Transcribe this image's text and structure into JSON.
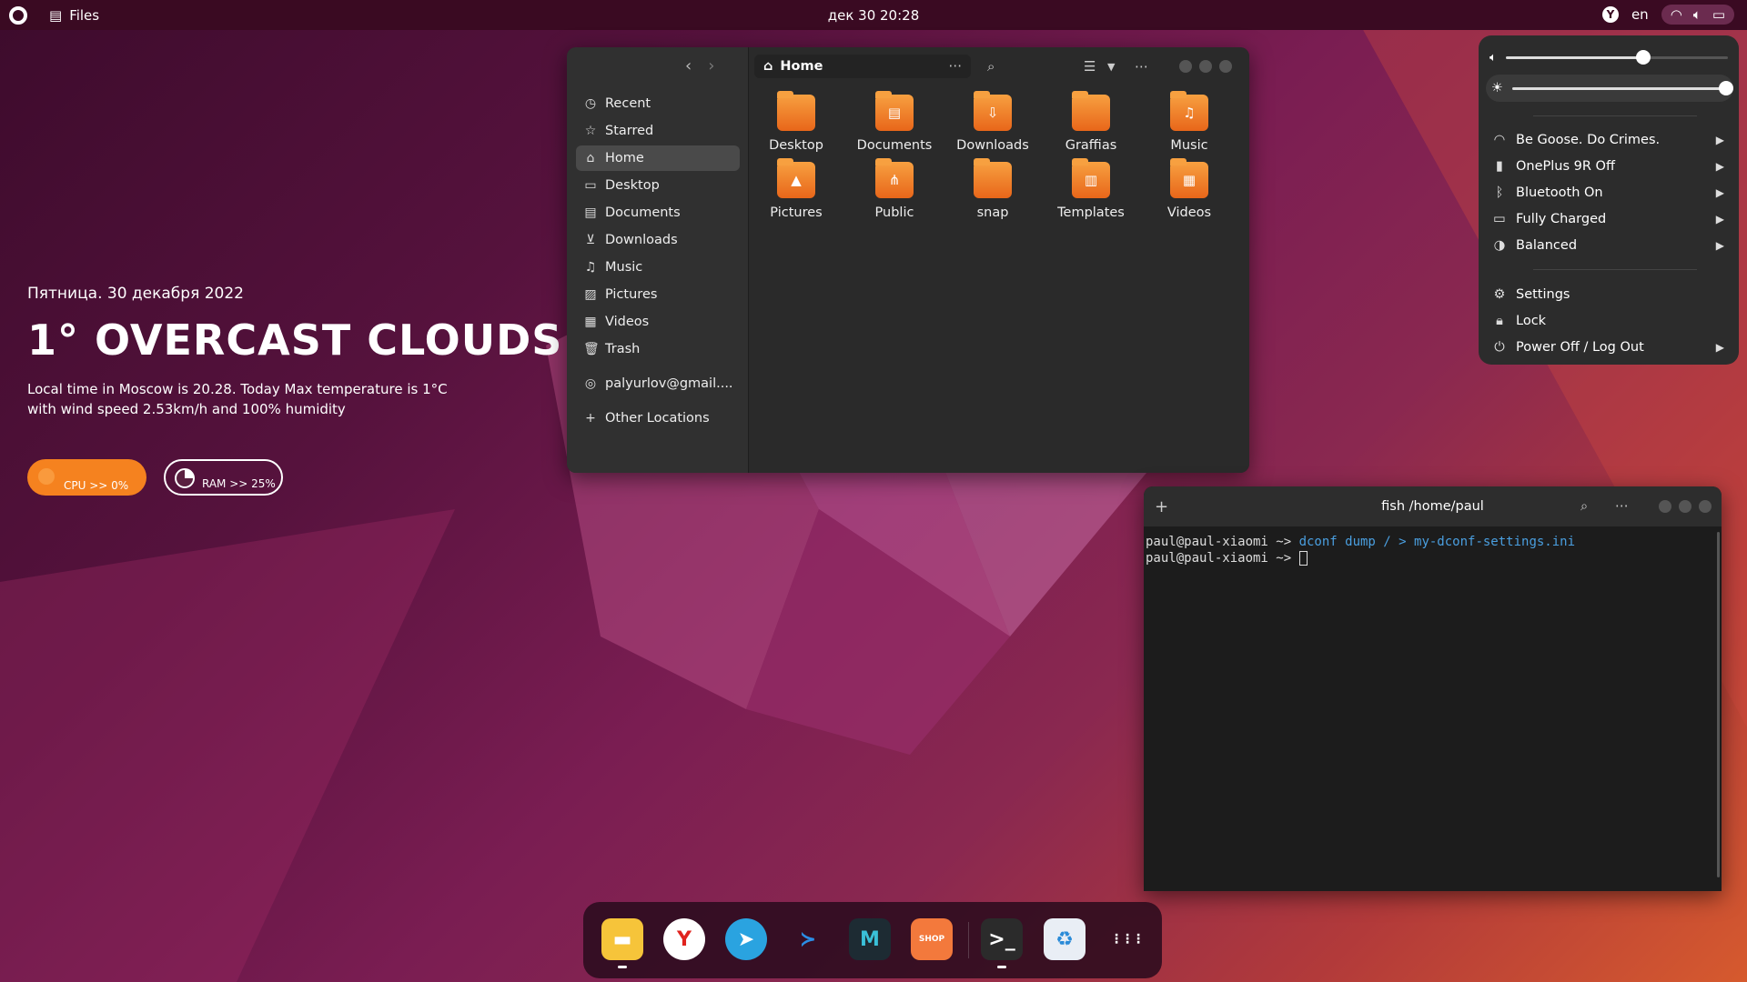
{
  "topbar": {
    "app_name": "Files",
    "clock": "дек 30  20:28",
    "lang": "en"
  },
  "weather": {
    "date": "Пятница. 30 декабря 2022",
    "title": "1° OVERCAST CLOUDS",
    "desc": "Local time in Moscow  is 20.28. Today Max temperature is 1°C with wind speed 2.53km/h and 100% humidity"
  },
  "meters": {
    "cpu": "CPU >> 0%",
    "ram": "RAM >> 25%",
    "cpu_level": 0,
    "ram_level": 0.25
  },
  "files": {
    "path": "Home",
    "sidebar": [
      {
        "label": "Recent",
        "icon": "clock-icon"
      },
      {
        "label": "Starred",
        "icon": "star-icon"
      },
      {
        "label": "Home",
        "icon": "home-icon"
      },
      {
        "label": "Desktop",
        "icon": "desktop-icon"
      },
      {
        "label": "Documents",
        "icon": "document-icon"
      },
      {
        "label": "Downloads",
        "icon": "download-icon"
      },
      {
        "label": "Music",
        "icon": "music-icon"
      },
      {
        "label": "Pictures",
        "icon": "picture-icon"
      },
      {
        "label": "Videos",
        "icon": "video-icon"
      },
      {
        "label": "Trash",
        "icon": "trash-icon"
      },
      {
        "label": "palyurlov@gmail....",
        "icon": "network-icon"
      },
      {
        "label": "Other Locations",
        "icon": "plus-icon"
      }
    ],
    "folders": [
      "Desktop",
      "Documents",
      "Downloads",
      "Graffias",
      "Music",
      "Pictures",
      "Public",
      "snap",
      "Templates",
      "Videos"
    ]
  },
  "terminal": {
    "title": "fish /home/paul",
    "prompt": "paul@paul-xiaomi ~> ",
    "command": "dconf dump / > my-dconf-settings.ini"
  },
  "quick_settings": {
    "volume_level": 0.62,
    "brightness_level": 1.0,
    "rows": [
      "Be Goose. Do Crimes.",
      "OnePlus 9R Off",
      "Bluetooth On",
      "Fully Charged",
      "Balanced"
    ],
    "actions": [
      "Settings",
      "Lock",
      "Power Off / Log Out"
    ]
  },
  "dock": [
    "Files",
    "Yandex Browser",
    "Telegram",
    "Visual Studio Code",
    "Mailspring",
    "Software Shop",
    "Terminal",
    "Recycle Bin",
    "Show Applications"
  ],
  "dock_shop_text": "SHOP"
}
